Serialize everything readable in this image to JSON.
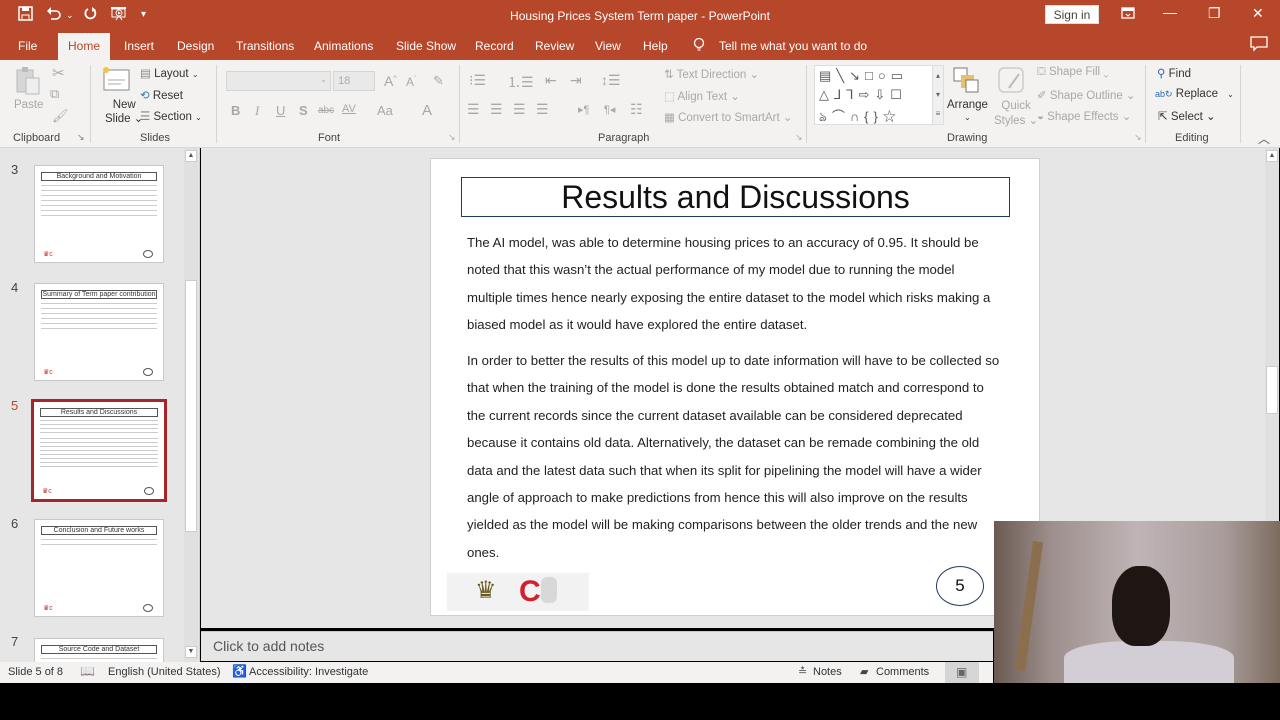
{
  "window": {
    "title": "Housing Prices System Term paper  -  PowerPoint",
    "sign_in": "Sign in",
    "controls": {
      "ribbon_display": "ribbon-display-icon",
      "minimize": "—",
      "restore": "❐",
      "close": "✕"
    }
  },
  "quick_access": {
    "save": "save-icon",
    "undo": "undo-icon",
    "redo": "redo-icon",
    "present": "present-icon",
    "customize": "customize-icon"
  },
  "tabs": [
    "File",
    "Home",
    "Insert",
    "Design",
    "Transitions",
    "Animations",
    "Slide Show",
    "Record",
    "Review",
    "View",
    "Help"
  ],
  "active_tab": "Home",
  "tell_me": "Tell me what you want to do",
  "ribbon": {
    "clipboard": {
      "label": "Clipboard",
      "paste": "Paste"
    },
    "slides": {
      "label": "Slides",
      "new_slide": "New\nSlide",
      "new_slide_line1": "New",
      "new_slide_line2": "Slide",
      "layout": "Layout",
      "reset": "Reset",
      "section": "Section"
    },
    "font": {
      "label": "Font",
      "font_name": "",
      "font_size": "18",
      "bold": "B",
      "italic": "I",
      "underline": "U",
      "strike": "S",
      "abc": "abc",
      "spacing": "AV",
      "case": "Aa",
      "color": "A"
    },
    "paragraph": {
      "label": "Paragraph",
      "text_direction": "Text Direction",
      "align_text": "Align Text",
      "convert_smartart": "Convert to SmartArt"
    },
    "drawing": {
      "label": "Drawing",
      "arrange": "Arrange",
      "quick_styles_line1": "Quick",
      "quick_styles_line2": "Styles",
      "shape_fill": "Shape Fill",
      "shape_outline": "Shape Outline",
      "shape_effects": "Shape Effects"
    },
    "editing": {
      "label": "Editing",
      "find": "Find",
      "replace": "Replace",
      "select": "Select"
    }
  },
  "thumbnails": [
    {
      "num": "3",
      "title": "Background and Motivation",
      "lines": 7
    },
    {
      "num": "4",
      "title": "Summary of Term paper contribution",
      "lines": 6
    },
    {
      "num": "5",
      "title": "Results and Discussions",
      "lines": 12,
      "selected": true
    },
    {
      "num": "6",
      "title": "Conclusion and Future works",
      "lines": 2
    },
    {
      "num": "7",
      "title": "Source Code and Dataset",
      "lines": 1
    }
  ],
  "slide": {
    "title": "Results and Discussions",
    "paragraphs": [
      "The AI model, was able to determine housing prices to an accuracy of 0.95. It should be noted that this wasn’t the actual performance of my model due to running the model multiple times hence nearly exposing the entire dataset to the model which risks making a biased model as it would have explored the entire dataset.",
      "In order to better the results of this model up to date information will have to be collected so that when the training of the model is done the results obtained match and correspond to the current records since the current dataset available can be considered deprecated because it contains old data. Alternatively, the dataset can be remade combining the old data and the latest data such that when its split for pipelining the model will have a wider angle of approach to make predictions from hence this will also improve on the results yielded as the model will be making comparisons between the older trends and the new ones."
    ],
    "page_number": "5"
  },
  "notes_placeholder": "Click to add notes",
  "status": {
    "slide_of": "Slide 5 of 8",
    "language": "English (United States)",
    "accessibility": "Accessibility: Investigate",
    "notes": "Notes",
    "comments": "Comments"
  }
}
